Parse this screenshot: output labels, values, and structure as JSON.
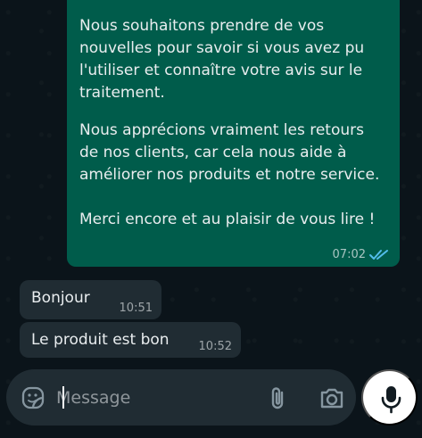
{
  "conversation": {
    "outgoing_message": {
      "paragraphs": [
        "Nous souhaitons prendre de vos nouvelles pour savoir si vous avez pu l'utiliser et connaître votre avis sur le traitement.",
        "Nous apprécions vraiment les retours de nos clients, car cela nous aide à améliorer nos produits et notre service.",
        "Merci encore et au plaisir de vous lire !"
      ],
      "time": "07:02",
      "status_icon": "double-check-icon"
    },
    "incoming_messages": [
      {
        "text": "Bonjour",
        "time": "10:51"
      },
      {
        "text": "Le produit est bon",
        "time": "10:52"
      }
    ]
  },
  "composer": {
    "placeholder": "Message",
    "emoji_icon": "sticker-icon",
    "attach_icon": "paperclip-icon",
    "camera_icon": "camera-icon",
    "mic_icon": "microphone-icon"
  },
  "colors": {
    "background": "#0b141a",
    "outgoing_bubble": "#005c4b",
    "incoming_bubble": "#202c33",
    "read_ticks": "#53bdeb"
  }
}
